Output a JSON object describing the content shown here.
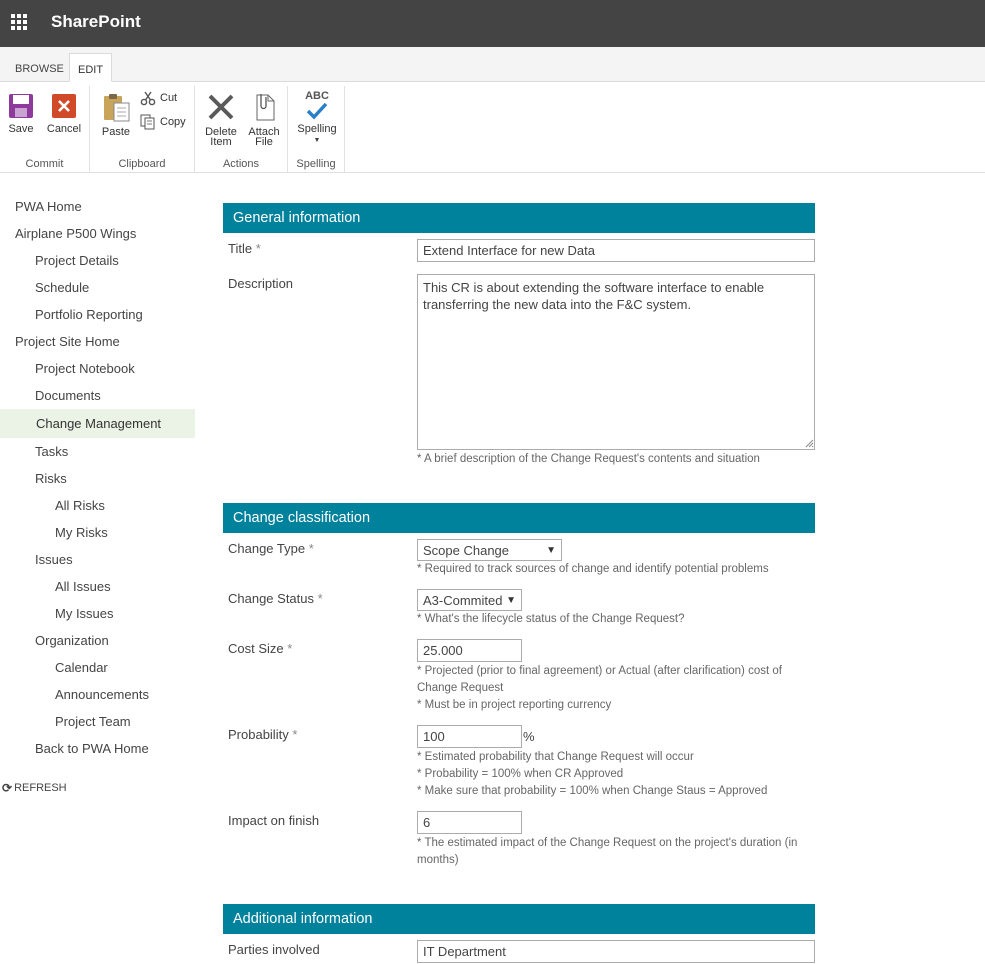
{
  "suitebar": {
    "brand": "SharePoint",
    "app_launcher_icon": "waffle-icon"
  },
  "ribbon": {
    "tabs": [
      {
        "label": "BROWSE"
      },
      {
        "label": "EDIT"
      }
    ],
    "groups": {
      "commit": {
        "label": "Commit",
        "save": "Save",
        "cancel": "Cancel"
      },
      "clipboard": {
        "label": "Clipboard",
        "paste": "Paste",
        "cut": "Cut",
        "copy": "Copy"
      },
      "actions": {
        "label": "Actions",
        "delete_line1": "Delete",
        "delete_line2": "Item",
        "attach_line1": "Attach",
        "attach_line2": "File"
      },
      "spelling": {
        "label": "Spelling",
        "spelling": "Spelling",
        "abc": "ABC"
      }
    }
  },
  "nav": {
    "items": [
      {
        "label": "PWA Home",
        "level": 1
      },
      {
        "label": "Airplane P500 Wings",
        "level": 1
      },
      {
        "label": "Project Details",
        "level": 2
      },
      {
        "label": "Schedule",
        "level": 2
      },
      {
        "label": "Portfolio Reporting",
        "level": 2
      },
      {
        "label": "Project Site Home",
        "level": 1
      },
      {
        "label": "Project Notebook",
        "level": 2
      },
      {
        "label": "Documents",
        "level": 2
      },
      {
        "label": "Change Management",
        "level": 2,
        "selected": true
      },
      {
        "label": "Tasks",
        "level": 2
      },
      {
        "label": "Risks",
        "level": 2
      },
      {
        "label": "All Risks",
        "level": 3
      },
      {
        "label": "My Risks",
        "level": 3
      },
      {
        "label": "Issues",
        "level": 2
      },
      {
        "label": "All Issues",
        "level": 3
      },
      {
        "label": "My Issues",
        "level": 3
      },
      {
        "label": "Organization",
        "level": 2
      },
      {
        "label": "Calendar",
        "level": 3
      },
      {
        "label": "Announcements",
        "level": 3
      },
      {
        "label": "Project Team",
        "level": 3
      },
      {
        "label": "Back to PWA Home",
        "level": 2
      }
    ],
    "refresh": "REFRESH"
  },
  "form": {
    "general": {
      "header": "General information",
      "title_label": "Title",
      "title_value": "Extend Interface for new Data",
      "description_label": "Description",
      "description_value": "This CR is about extending the software interface to enable transferring the new data into the F&C system.",
      "description_hint": "* A brief description of the Change Request's contents and situation"
    },
    "classification": {
      "header": "Change classification",
      "type_label": "Change Type",
      "type_value": "Scope Change",
      "type_hint": "* Required to track sources of change and identify potential problems",
      "status_label": "Change Status",
      "status_value": "A3-Commited",
      "status_hint": "* What's the lifecycle status of the Change Request?",
      "cost_label": "Cost Size",
      "cost_value": "25.000",
      "cost_hint_1": "* Projected (prior to final agreement) or Actual (after clarification) cost of",
      "cost_hint_2": "Change Request",
      "cost_hint_3": "* Must be in project reporting currency",
      "prob_label": "Probability",
      "prob_value": "100",
      "prob_unit": "%",
      "prob_hint_1": "* Estimated probability that Change Request will occur",
      "prob_hint_2": "* Probability = 100% when CR Approved",
      "prob_hint_3": "* Make sure that probability = 100% when Change Staus = Approved",
      "impact_label": "Impact on finish",
      "impact_value": "6",
      "impact_hint_1": "* The estimated impact of the Change Request on the project's duration (in",
      "impact_hint_2": "months)"
    },
    "additional": {
      "header": "Additional information",
      "parties_label": "Parties involved",
      "parties_value": "IT Department"
    },
    "required_marker": "*"
  },
  "colors": {
    "suitebar": "#444444",
    "section_header": "#00819c",
    "nav_selected": "#eaf3e6"
  }
}
